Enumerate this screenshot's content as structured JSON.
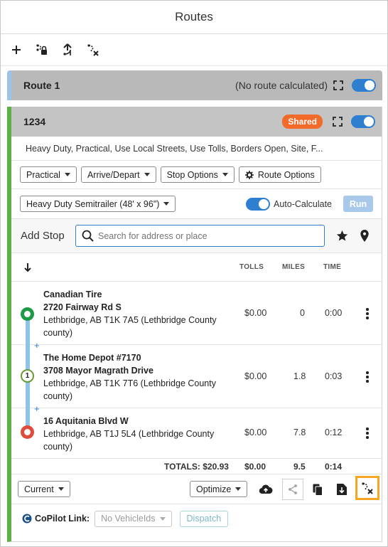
{
  "header": {
    "title": "Routes"
  },
  "toolbar": {
    "icons": [
      "add-icon",
      "delete-route-icon",
      "share-route-icon",
      "remove-stops-icon"
    ]
  },
  "route1": {
    "name": "Route 1",
    "status": "(No route calculated)"
  },
  "route": {
    "name": "1234",
    "shared_badge": "Shared",
    "summary": "Heavy Duty, Practical, Use Local Streets, Use Tolls, Borders Open, Site, F...",
    "options": {
      "routing_type": "Practical",
      "arrive_depart": "Arrive/Depart",
      "stop_options": "Stop Options",
      "route_options": "Route Options"
    },
    "vehicle": "Heavy Duty Semitrailer (48' x 96\")",
    "auto_calculate_label": "Auto-Calculate",
    "run_label": "Run"
  },
  "add_stop": {
    "label": "Add Stop",
    "placeholder": "Search for address or place"
  },
  "columns": {
    "tolls": "TOLLS",
    "miles": "MILES",
    "time": "TIME"
  },
  "stops": [
    {
      "line1": "Canadian Tire",
      "line2": "2720 Fairway Rd S",
      "line3": "Lethbridge, AB T1K 7A5 (Lethbridge County county)",
      "tolls": "$0.00",
      "miles": "0",
      "time": "0:00",
      "marker_label": "",
      "marker_color": "#1f9a48"
    },
    {
      "line1": "The Home Depot #7170",
      "line2": "3708 Mayor Magrath Drive",
      "line3": "Lethbridge, AB T1K 7T6 (Lethbridge County county)",
      "tolls": "$0.00",
      "miles": "1.8",
      "time": "0:03",
      "marker_label": "1",
      "marker_color": "#6b9b35"
    },
    {
      "line1": "16 Aquitania Blvd W",
      "line2": "Lethbridge, AB T1J 5L4 (Lethbridge County county)",
      "tolls": "$0.00",
      "miles": "7.8",
      "time": "0:12",
      "marker_label": "",
      "marker_color": "#e04b3b"
    }
  ],
  "totals": {
    "label": "TOTALS: $20.93",
    "tolls": "$0.00",
    "miles": "9.5",
    "time": "0:14"
  },
  "bottom_bar": {
    "current_label": "Current",
    "optimize_label": "Optimize"
  },
  "copilot": {
    "label": "CoPilot Link:",
    "vehicle_select": "No VehicleIds",
    "dispatch_label": "Dispatch"
  },
  "colors": {
    "accent_blue": "#2f7fd0",
    "route_green": "#5db043",
    "shared_orange": "#f26b2a",
    "highlight_orange": "#f5a623"
  }
}
